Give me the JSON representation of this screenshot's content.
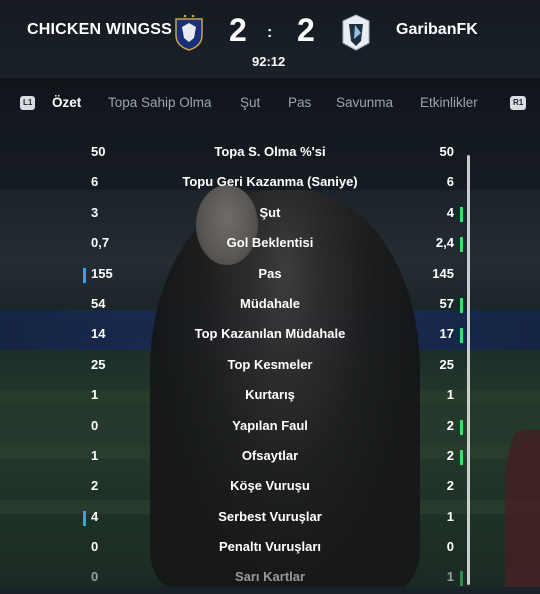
{
  "header": {
    "home_team": "CHICKEN WINGSS",
    "away_team": "GaribanFK",
    "home_score": "2",
    "away_score": "2",
    "separator": ":",
    "clock": "92:12",
    "home_crest": "france-crest-icon",
    "away_crest": "minnesota-crest-icon"
  },
  "tabs": {
    "left_button": "L1",
    "right_button": "R1",
    "items": [
      "Özet",
      "Topa Sahip Olma",
      "Şut",
      "Pas",
      "Savunma",
      "Etkinlikler"
    ],
    "active": "Özet"
  },
  "stats": [
    {
      "name": "Topa S. Olma %'si",
      "home": "50",
      "away": "50",
      "leader": "none"
    },
    {
      "name": "Topu Geri Kazanma (Saniye)",
      "home": "6",
      "away": "6",
      "leader": "none"
    },
    {
      "name": "Şut",
      "home": "3",
      "away": "4",
      "leader": "away"
    },
    {
      "name": "Gol Beklentisi",
      "home": "0,7",
      "away": "2,4",
      "leader": "away"
    },
    {
      "name": "Pas",
      "home": "155",
      "away": "145",
      "leader": "home"
    },
    {
      "name": "Müdahale",
      "home": "54",
      "away": "57",
      "leader": "away"
    },
    {
      "name": "Top Kazanılan Müdahale",
      "home": "14",
      "away": "17",
      "leader": "away"
    },
    {
      "name": "Top Kesmeler",
      "home": "25",
      "away": "25",
      "leader": "none"
    },
    {
      "name": "Kurtarış",
      "home": "1",
      "away": "1",
      "leader": "none"
    },
    {
      "name": "Yapılan Faul",
      "home": "0",
      "away": "2",
      "leader": "away"
    },
    {
      "name": "Ofsaytlar",
      "home": "1",
      "away": "2",
      "leader": "away"
    },
    {
      "name": "Köşe Vuruşu",
      "home": "2",
      "away": "2",
      "leader": "none"
    },
    {
      "name": "Serbest Vuruşlar",
      "home": "4",
      "away": "1",
      "leader": "home"
    },
    {
      "name": "Penaltı Vuruşları",
      "home": "0",
      "away": "0",
      "leader": "none"
    },
    {
      "name": "Sarı Kartlar",
      "home": "0",
      "away": "1",
      "leader": "away"
    }
  ],
  "colors": {
    "home_leader_bar": "#3aa0ff",
    "away_leader_bar": "#39e26d"
  }
}
